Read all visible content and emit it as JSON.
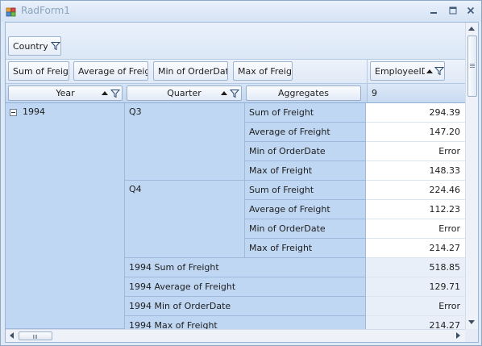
{
  "window": {
    "title": "RadForm1"
  },
  "filter_area": {
    "fields": [
      {
        "label": "Country"
      }
    ]
  },
  "aggregate_area": {
    "fields": [
      {
        "label": "Sum of Freig"
      },
      {
        "label": "Average of Freig"
      },
      {
        "label": "Min of OrderDat"
      },
      {
        "label": "Max of Freig"
      }
    ]
  },
  "column_area": {
    "fields": [
      {
        "label": "EmployeeID"
      }
    ]
  },
  "row_headers": {
    "year": "Year",
    "quarter": "Quarter",
    "aggregates": "Aggregates"
  },
  "column_values": [
    "9"
  ],
  "grid": {
    "year": "1994",
    "quarters": [
      {
        "label": "Q3",
        "rows": [
          {
            "agg": "Sum of Freight",
            "value": "294.39"
          },
          {
            "agg": "Average of Freight",
            "value": "147.20"
          },
          {
            "agg": "Min of OrderDate",
            "value": "Error"
          },
          {
            "agg": "Max of Freight",
            "value": "148.33"
          }
        ]
      },
      {
        "label": "Q4",
        "rows": [
          {
            "agg": "Sum of Freight",
            "value": "224.46"
          },
          {
            "agg": "Average of Freight",
            "value": "112.23"
          },
          {
            "agg": "Min of OrderDate",
            "value": "Error"
          },
          {
            "agg": "Max of Freight",
            "value": "214.27"
          }
        ]
      }
    ],
    "totals": [
      {
        "label": "1994 Sum of Freight",
        "value": "518.85"
      },
      {
        "label": "1994 Average of Freight",
        "value": "129.71"
      },
      {
        "label": "1994 Min of OrderDate",
        "value": "Error"
      },
      {
        "label": "1994 Max of Freight",
        "value": "214.27"
      }
    ]
  },
  "icons": {
    "app": "app-icon",
    "minimize": "minimize-icon",
    "maximize": "maximize-icon",
    "close": "close-icon",
    "filter": "funnel-icon",
    "sort": "sort-ascending-icon",
    "collapse": "collapse-icon"
  },
  "colors": {
    "header_cell": "#bfd7f3",
    "total_value": "#e9eff8",
    "window_frame": "#dfe9f5"
  }
}
